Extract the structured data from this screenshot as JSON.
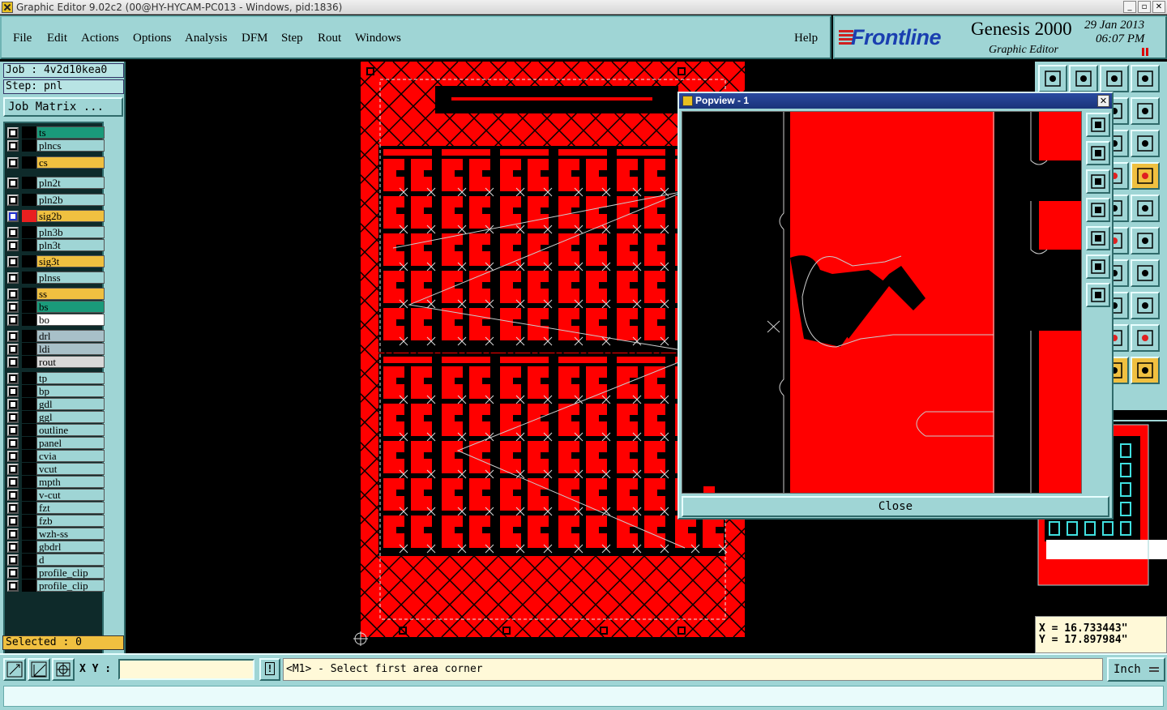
{
  "window": {
    "title": "Graphic Editor 9.02c2 (00@HY-HYCAM-PC013 - Windows, pid:1836)"
  },
  "menu": [
    {
      "label": "File"
    },
    {
      "label": "Edit"
    },
    {
      "label": "Actions"
    },
    {
      "label": "Options"
    },
    {
      "label": "Analysis"
    },
    {
      "label": "DFM"
    },
    {
      "label": "Step"
    },
    {
      "label": "Rout"
    },
    {
      "label": "Windows"
    },
    {
      "label": "Help"
    }
  ],
  "brand": {
    "logo": "Frontline",
    "product": "Genesis 2000",
    "subtitle": "Graphic Editor",
    "date": "29 Jan 2013",
    "time": "06:07 PM"
  },
  "job": {
    "job_label": "Job : 4v2d10kea0",
    "step_label": "Step: pnl",
    "matrix_button": "Job Matrix ..."
  },
  "layers": [
    {
      "name": "ts",
      "color": "#1a9a7a"
    },
    {
      "name": "plncs",
      "color": "#9fd5d5"
    },
    {
      "name": "cs",
      "color": "#f0c040"
    },
    {
      "name": "pln2t",
      "color": "#9fd5d5"
    },
    {
      "name": "pln2b",
      "color": "#9fd5d5"
    },
    {
      "name": "sig2b",
      "color": "#f0c040",
      "selected": true
    },
    {
      "name": "pln3b",
      "color": "#9fd5d5"
    },
    {
      "name": "pln3t",
      "color": "#9fd5d5"
    },
    {
      "name": "sig3t",
      "color": "#f0c040"
    },
    {
      "name": "plnss",
      "color": "#9fd5d5"
    },
    {
      "name": "ss",
      "color": "#f0c040"
    },
    {
      "name": "bs",
      "color": "#1a9a7a"
    },
    {
      "name": "bo",
      "color": "#ffffff"
    },
    {
      "name": "drl",
      "color": "#a8c0c8"
    },
    {
      "name": "ldi",
      "color": "#a8c0c8"
    },
    {
      "name": "rout",
      "color": "#d8d8d8"
    },
    {
      "name": "tp",
      "color": "#9fd5d5"
    },
    {
      "name": "bp",
      "color": "#9fd5d5"
    },
    {
      "name": "gdl",
      "color": "#9fd5d5"
    },
    {
      "name": "ggl",
      "color": "#9fd5d5"
    },
    {
      "name": "outline",
      "color": "#9fd5d5"
    },
    {
      "name": "panel",
      "color": "#9fd5d5"
    },
    {
      "name": "cvia",
      "color": "#9fd5d5"
    },
    {
      "name": "vcut",
      "color": "#9fd5d5"
    },
    {
      "name": "mpth",
      "color": "#9fd5d5"
    },
    {
      "name": "v-cut",
      "color": "#9fd5d5"
    },
    {
      "name": "fzt",
      "color": "#9fd5d5"
    },
    {
      "name": "fzb",
      "color": "#9fd5d5"
    },
    {
      "name": "wzh-ss",
      "color": "#9fd5d5"
    },
    {
      "name": "gbdrl",
      "color": "#9fd5d5"
    },
    {
      "name": "d",
      "color": "#9fd5d5"
    },
    {
      "name": "profile_clip",
      "color": "#9fd5d5"
    },
    {
      "name": "profile_clip",
      "color": "#9fd5d5"
    }
  ],
  "selected_label": "Selected : 0",
  "popview": {
    "title": "Popview - 1",
    "close_label": "Close"
  },
  "coords": {
    "x": "X = 16.733443\"",
    "y": "Y = 17.897984\""
  },
  "bottom": {
    "xy_label": "X Y :",
    "xy_value": "",
    "bang_label": "!",
    "prompt": "<M1> - Select first area corner",
    "units": "Inch"
  },
  "colors": {
    "panel": "#9fd5d5",
    "copper": "#ff0000",
    "highlight": "#f0c040",
    "window_title": "#1a347a"
  }
}
